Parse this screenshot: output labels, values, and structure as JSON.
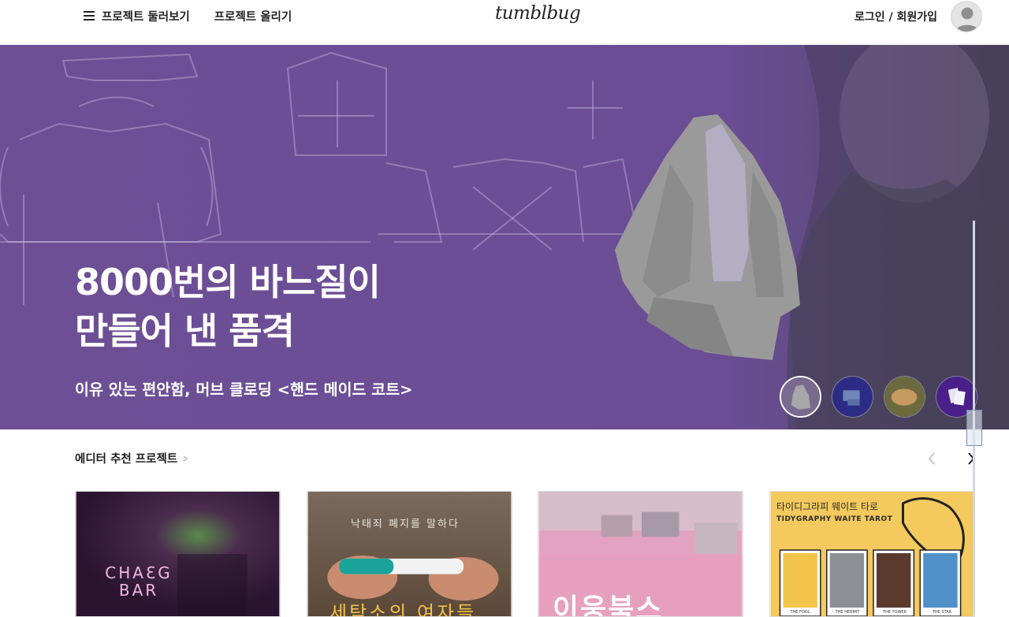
{
  "header": {
    "nav_browse": "프로젝트 둘러보기",
    "nav_upload": "프로젝트 올리기",
    "logo": "tumblbug",
    "login": "로그인 / 회원가입"
  },
  "hero": {
    "title": "8000번의 바느질이\n만들어 낸 품격",
    "subtitle": "이유 있는 편안함, 머브 클로딩 <핸드 메이드 코트>",
    "background_color": "#6c4e97",
    "thumbnails": [
      {
        "name": "coat",
        "active": true
      },
      {
        "name": "blue-objects",
        "active": false
      },
      {
        "name": "bread",
        "active": false
      },
      {
        "name": "cards",
        "active": false
      }
    ]
  },
  "editor_picks": {
    "heading": "에디터 추천 프로젝트",
    "cards": [
      {
        "text": "CHAƐG BAR",
        "bg": "#3b1c3a"
      },
      {
        "text_top": "낙태죄 폐지를 말하다",
        "text_bottom": "세탁소의 여자들",
        "bg": "#6e5a4e"
      },
      {
        "text": "이웅북스",
        "bg": "#e6a7c0"
      },
      {
        "text_ko": "타이디그라피 웨이트 타로",
        "text_en": "TIDYGRAPHY WAITE TAROT",
        "bg": "#f4c95d",
        "tarot_cards": [
          "THE FOOL",
          "THE HERMIT",
          "THE TOWER",
          "THE STAR"
        ]
      }
    ]
  }
}
